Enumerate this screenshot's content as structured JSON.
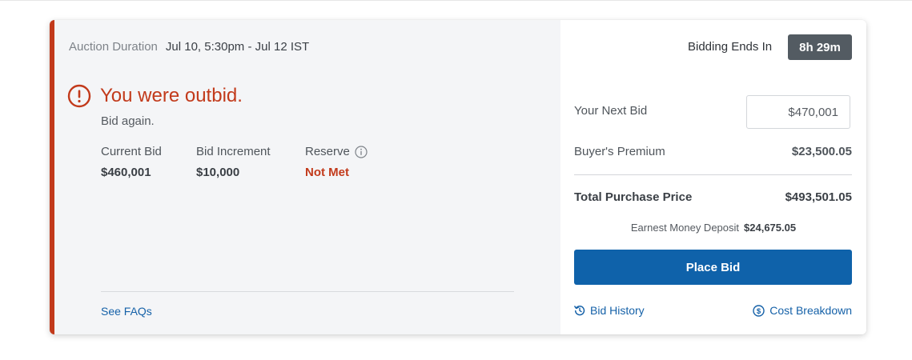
{
  "auction": {
    "duration_label": "Auction Duration",
    "duration_value": "Jul 10, 5:30pm - Jul 12 IST"
  },
  "alert": {
    "title": "You were outbid.",
    "subtitle": "Bid again."
  },
  "stats": [
    {
      "label": "Current Bid",
      "value": "$460,001"
    },
    {
      "label": "Bid Increment",
      "value": "$10,000"
    },
    {
      "label": "Reserve",
      "value": "Not Met"
    }
  ],
  "links": {
    "faq": "See FAQs",
    "bid_history": "Bid History",
    "cost_breakdown": "Cost Breakdown"
  },
  "bidding": {
    "ends_label": "Bidding Ends In",
    "time_left": "8h 29m",
    "next_bid_label": "Your Next Bid",
    "next_bid_value": "$470,001",
    "premium_label": "Buyer's Premium",
    "premium_value": "$23,500.05",
    "total_label": "Total Purchase Price",
    "total_value": "$493,501.05",
    "earnest_label": "Earnest Money Deposit",
    "earnest_value": "$24,675.05",
    "place_bid_label": "Place Bid"
  },
  "icons": {
    "alert": "exclamation-circle-icon",
    "info": "info-circle-icon",
    "history": "history-icon",
    "cost": "dollar-circle-icon"
  },
  "colors": {
    "alert_red": "#c23a1b",
    "primary_blue": "#0f62aa",
    "link_blue": "#1561a8",
    "timer_bg": "#535b62",
    "left_panel_bg": "#f4f5f7"
  }
}
